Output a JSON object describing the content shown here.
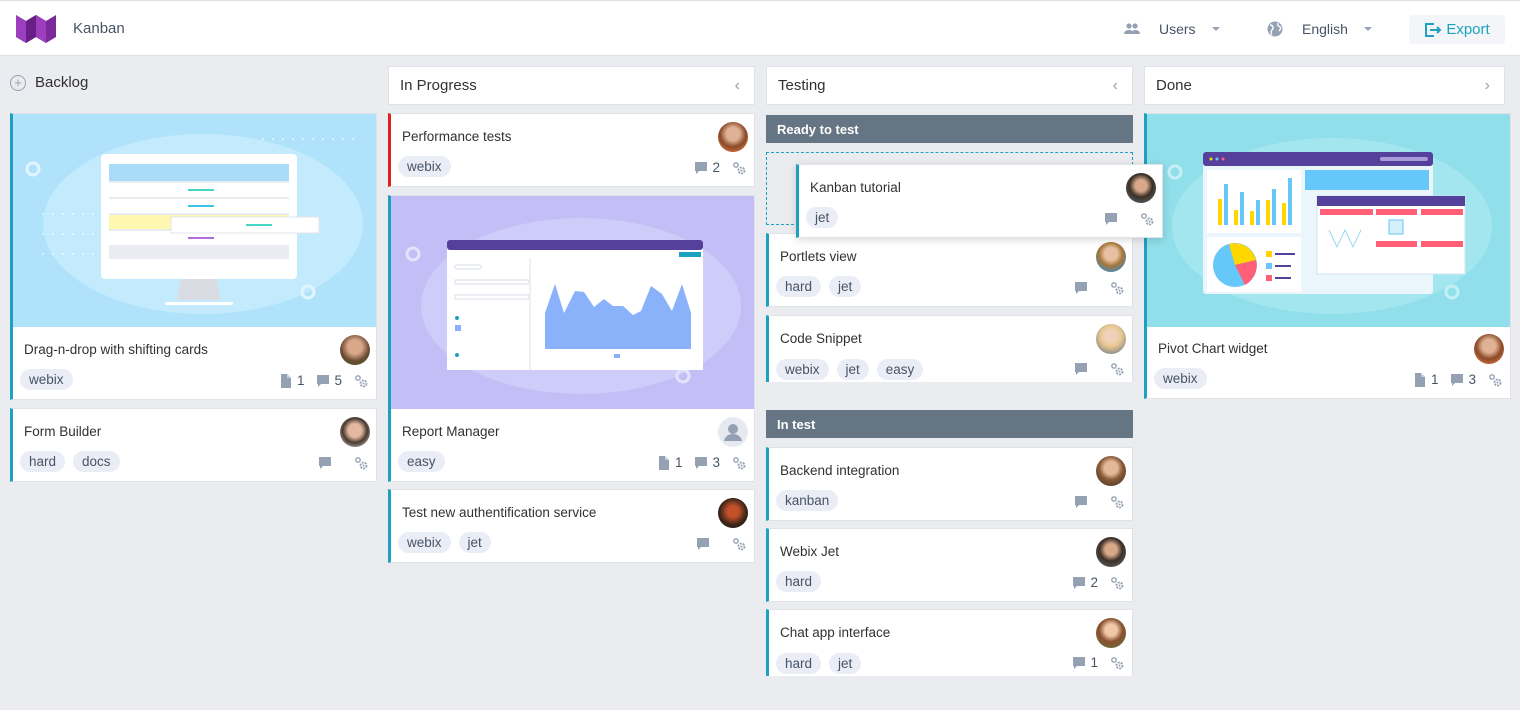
{
  "app": {
    "title": "Kanban",
    "logo_icon": "webix-logo-icon"
  },
  "toolbar": {
    "users_label": "Users",
    "users_icon": "users-icon",
    "language_label": "English",
    "language_icon": "globe-icon",
    "export_label": "Export",
    "export_icon": "export-icon"
  },
  "colors": {
    "accent": "#1ca1c1",
    "priority_high": "#e41e1e",
    "subheader_bg": "#657584",
    "tag_bg": "#eaedf5",
    "board_bg": "#ebecef"
  },
  "columns": {
    "backlog": {
      "title": "Backlog",
      "cards": [
        {
          "title": "Drag-n-drop with shifting cards",
          "tags": [
            "webix"
          ],
          "attachments": "1",
          "comments": "5",
          "has_image": true
        },
        {
          "title": "Form Builder",
          "tags": [
            "hard",
            "docs"
          ],
          "attachments": "",
          "comments": ""
        }
      ]
    },
    "in_progress": {
      "title": "In Progress",
      "cards": [
        {
          "title": "Performance tests",
          "tags": [
            "webix"
          ],
          "comments": "2",
          "priority": "high"
        },
        {
          "title": "Report Manager",
          "tags": [
            "easy"
          ],
          "attachments": "1",
          "comments": "3",
          "has_image": true,
          "avatar": "placeholder"
        },
        {
          "title": "Test new authentification service",
          "tags": [
            "webix",
            "jet"
          ],
          "comments": ""
        }
      ]
    },
    "testing": {
      "title": "Testing",
      "groups": [
        {
          "title": "Ready to test",
          "dragging_card": {
            "title": "Kanban tutorial",
            "tags": [
              "jet"
            ],
            "comments": ""
          },
          "cards": [
            {
              "title": "Portlets view",
              "tags": [
                "hard",
                "jet"
              ],
              "comments": ""
            },
            {
              "title": "Code Snippet",
              "tags": [
                "webix",
                "jet",
                "easy"
              ],
              "comments": ""
            }
          ]
        },
        {
          "title": "In test",
          "cards": [
            {
              "title": "Backend integration",
              "tags": [
                "kanban"
              ],
              "comments": ""
            },
            {
              "title": "Webix Jet",
              "tags": [
                "hard"
              ],
              "comments": "2"
            },
            {
              "title": "Chat app interface",
              "tags": [
                "hard",
                "jet"
              ],
              "comments": "1"
            }
          ]
        }
      ]
    },
    "done": {
      "title": "Done",
      "cards": [
        {
          "title": "Pivot Chart widget",
          "tags": [
            "webix"
          ],
          "attachments": "1",
          "comments": "3",
          "has_image": true
        }
      ]
    }
  }
}
